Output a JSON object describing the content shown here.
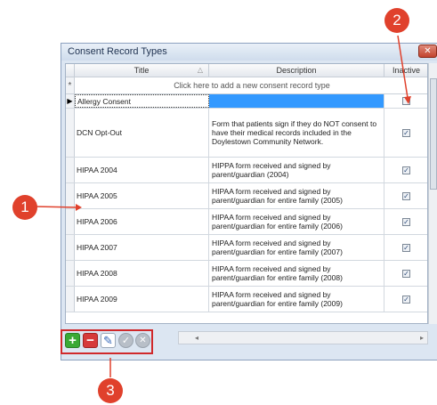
{
  "window": {
    "title": "Consent Record Types",
    "close_glyph": "✕"
  },
  "grid": {
    "columns": [
      "Title",
      "Description",
      "Inactive"
    ],
    "title_sort_glyph": "△",
    "new_row_marker": "*",
    "new_row_text": "Click here to add a new consent record type",
    "current_row_marker": "▶",
    "rows": [
      {
        "title": "Allergy Consent",
        "description": "",
        "inactive": false
      },
      {
        "title": "DCN Opt-Out",
        "description": "Form that patients sign if they do NOT consent to have their medical records included in the Doylestown Community Network.",
        "inactive": true
      },
      {
        "title": "HIPAA 2004",
        "description": "HIPPA form received and signed by parent/guardian (2004)",
        "inactive": true
      },
      {
        "title": "HIPAA 2005",
        "description": "HIPAA form received and signed by parent/guardian for entire family (2005)",
        "inactive": true
      },
      {
        "title": "HIPAA 2006",
        "description": "HIPAA form received and signed by parent/guardian for entire family (2006)",
        "inactive": true
      },
      {
        "title": "HIPAA 2007",
        "description": "HIPAA form received and signed by parent/guardian for entire family (2007)",
        "inactive": true
      },
      {
        "title": "HIPAA 2008",
        "description": "HIPAA form received and signed by parent/guardian for entire family (2008)",
        "inactive": true
      },
      {
        "title": "HIPAA 2009",
        "description": "HIPAA form received and signed by parent/guardian for entire family (2009)",
        "inactive": true
      }
    ]
  },
  "toolbar": {
    "buttons": [
      {
        "icon": "add-icon",
        "glyph": "+",
        "color": "#3aa935"
      },
      {
        "icon": "remove-icon",
        "glyph": "−",
        "color": "#d63a3a"
      },
      {
        "icon": "edit-pencil-icon",
        "glyph": "✎",
        "color": "#2f63b6"
      },
      {
        "icon": "accept-icon",
        "glyph": "✓",
        "color": "#b8bfc8"
      },
      {
        "icon": "cancel-icon",
        "glyph": "✕",
        "color": "#b8bfc8"
      }
    ]
  },
  "callouts": [
    "1",
    "2",
    "3"
  ],
  "colors": {
    "callout": "#e0412c",
    "highlight_box": "#d0292b",
    "selection": "#3399ff"
  }
}
